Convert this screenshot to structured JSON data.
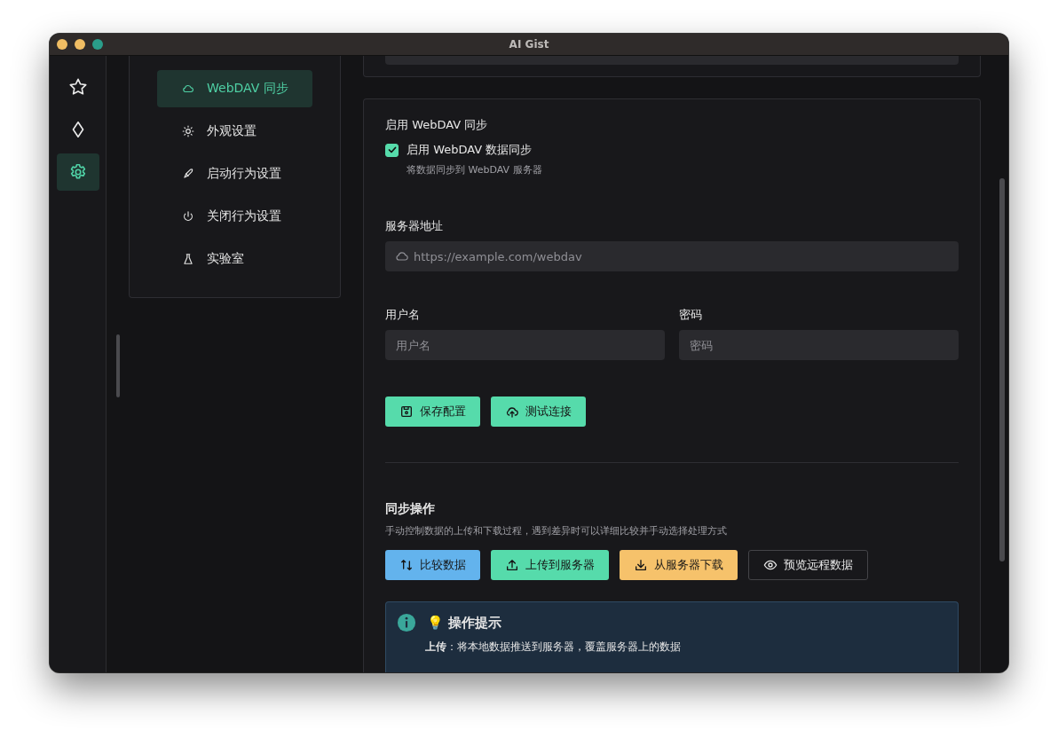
{
  "window": {
    "title": "AI Gist"
  },
  "rail": [
    {
      "selected": false
    },
    {
      "selected": false
    },
    {
      "selected": true
    }
  ],
  "settings_nav": [
    {
      "label": "WebDAV 同步",
      "selected": true
    },
    {
      "label": "外观设置",
      "selected": false
    },
    {
      "label": "启动行为设置",
      "selected": false
    },
    {
      "label": "关闭行为设置",
      "selected": false
    },
    {
      "label": "实验室",
      "selected": false
    }
  ],
  "webdav": {
    "section_title": "启用 WebDAV 同步",
    "enable": {
      "label": "启用 WebDAV 数据同步",
      "hint": "将数据同步到 WebDAV 服务器",
      "checked": true
    },
    "server": {
      "label": "服务器地址",
      "placeholder": "https://example.com/webdav"
    },
    "username": {
      "label": "用户名",
      "placeholder": "用户名"
    },
    "password": {
      "label": "密码",
      "placeholder": "密码"
    },
    "buttons": [
      "保存配置",
      "测试连接"
    ]
  },
  "sync": {
    "title": "同步操作",
    "description": "手动控制数据的上传和下载过程，遇到差异时可以详细比较并手动选择处理方式",
    "buttons": [
      {
        "label": "比较数据",
        "kind": "filled",
        "color": "#63b3ed"
      },
      {
        "label": "上传到服务器",
        "kind": "filled",
        "color": "#56dbab"
      },
      {
        "label": "从服务器下载",
        "kind": "filled",
        "color": "#f6c26b"
      },
      {
        "label": "预览远程数据",
        "kind": "outline"
      }
    ]
  },
  "tip": {
    "title": "💡 操作提示",
    "lines": [
      "**上传**：将本地数据推送到服务器，覆盖服务器上的数据"
    ]
  }
}
